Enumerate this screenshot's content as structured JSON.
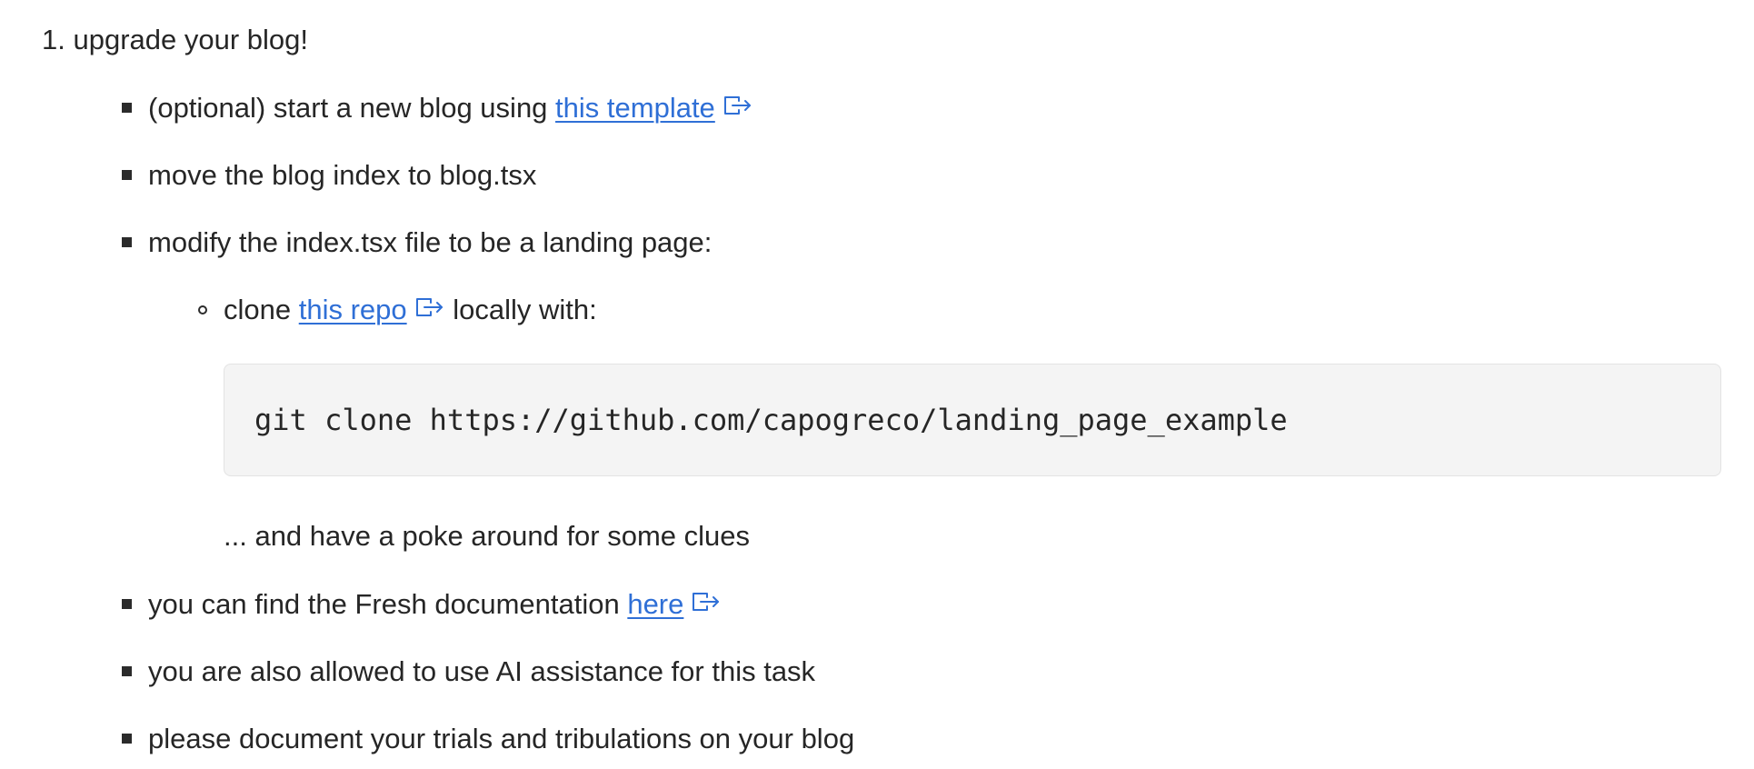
{
  "item1": {
    "number": "1.",
    "text": "upgrade your blog!"
  },
  "bullets": {
    "b1_prefix": "(optional) start a new blog using ",
    "b1_link": "this template",
    "b2": "move the blog index to blog.tsx",
    "b3": "modify the index.tsx file to be a landing page:",
    "sub1_prefix": "clone ",
    "sub1_link": "this repo",
    "sub1_suffix": " locally with:",
    "code": "git clone https://github.com/capogreco/landing_page_example",
    "after_code": "... and have a poke around for some clues",
    "b4_prefix": "you can find the Fresh documentation ",
    "b4_link": "here",
    "b5": "you are also allowed to use AI assistance for this task",
    "b6": "please document your trials and tribulations on your blog"
  },
  "icons": {
    "external_link": "external-link-icon"
  },
  "colors": {
    "link": "#2f6fd6",
    "text": "#262626",
    "code_bg": "#f4f4f4"
  }
}
